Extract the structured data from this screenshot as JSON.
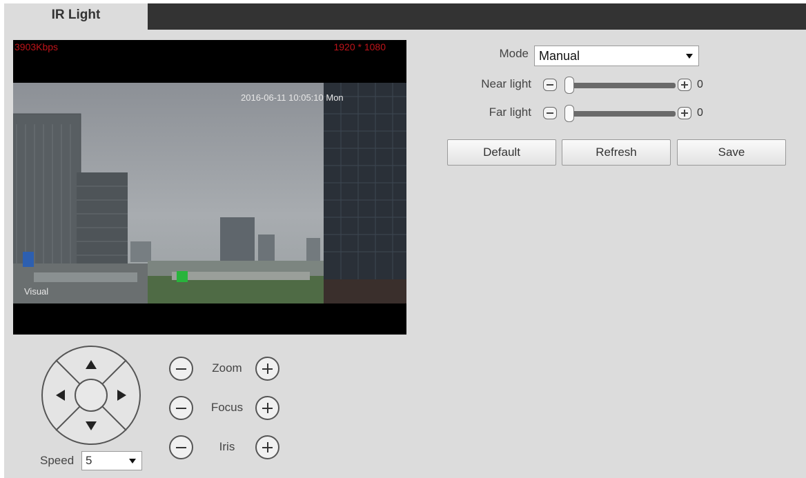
{
  "tab": {
    "label": "IR Light"
  },
  "video": {
    "bitrate": "3903Kbps",
    "resolution": "1920 * 1080",
    "timestamp": "2016-06-11 10:05:10 Mon",
    "channel_name": "Visual"
  },
  "ptz": {
    "zoom_label": "Zoom",
    "focus_label": "Focus",
    "iris_label": "Iris",
    "speed_label": "Speed",
    "speed_value": "5"
  },
  "settings": {
    "mode_label": "Mode",
    "mode_value": "Manual",
    "near_light": {
      "label": "Near light",
      "value": "0"
    },
    "far_light": {
      "label": "Far light",
      "value": "0"
    }
  },
  "buttons": {
    "default": "Default",
    "refresh": "Refresh",
    "save": "Save"
  }
}
